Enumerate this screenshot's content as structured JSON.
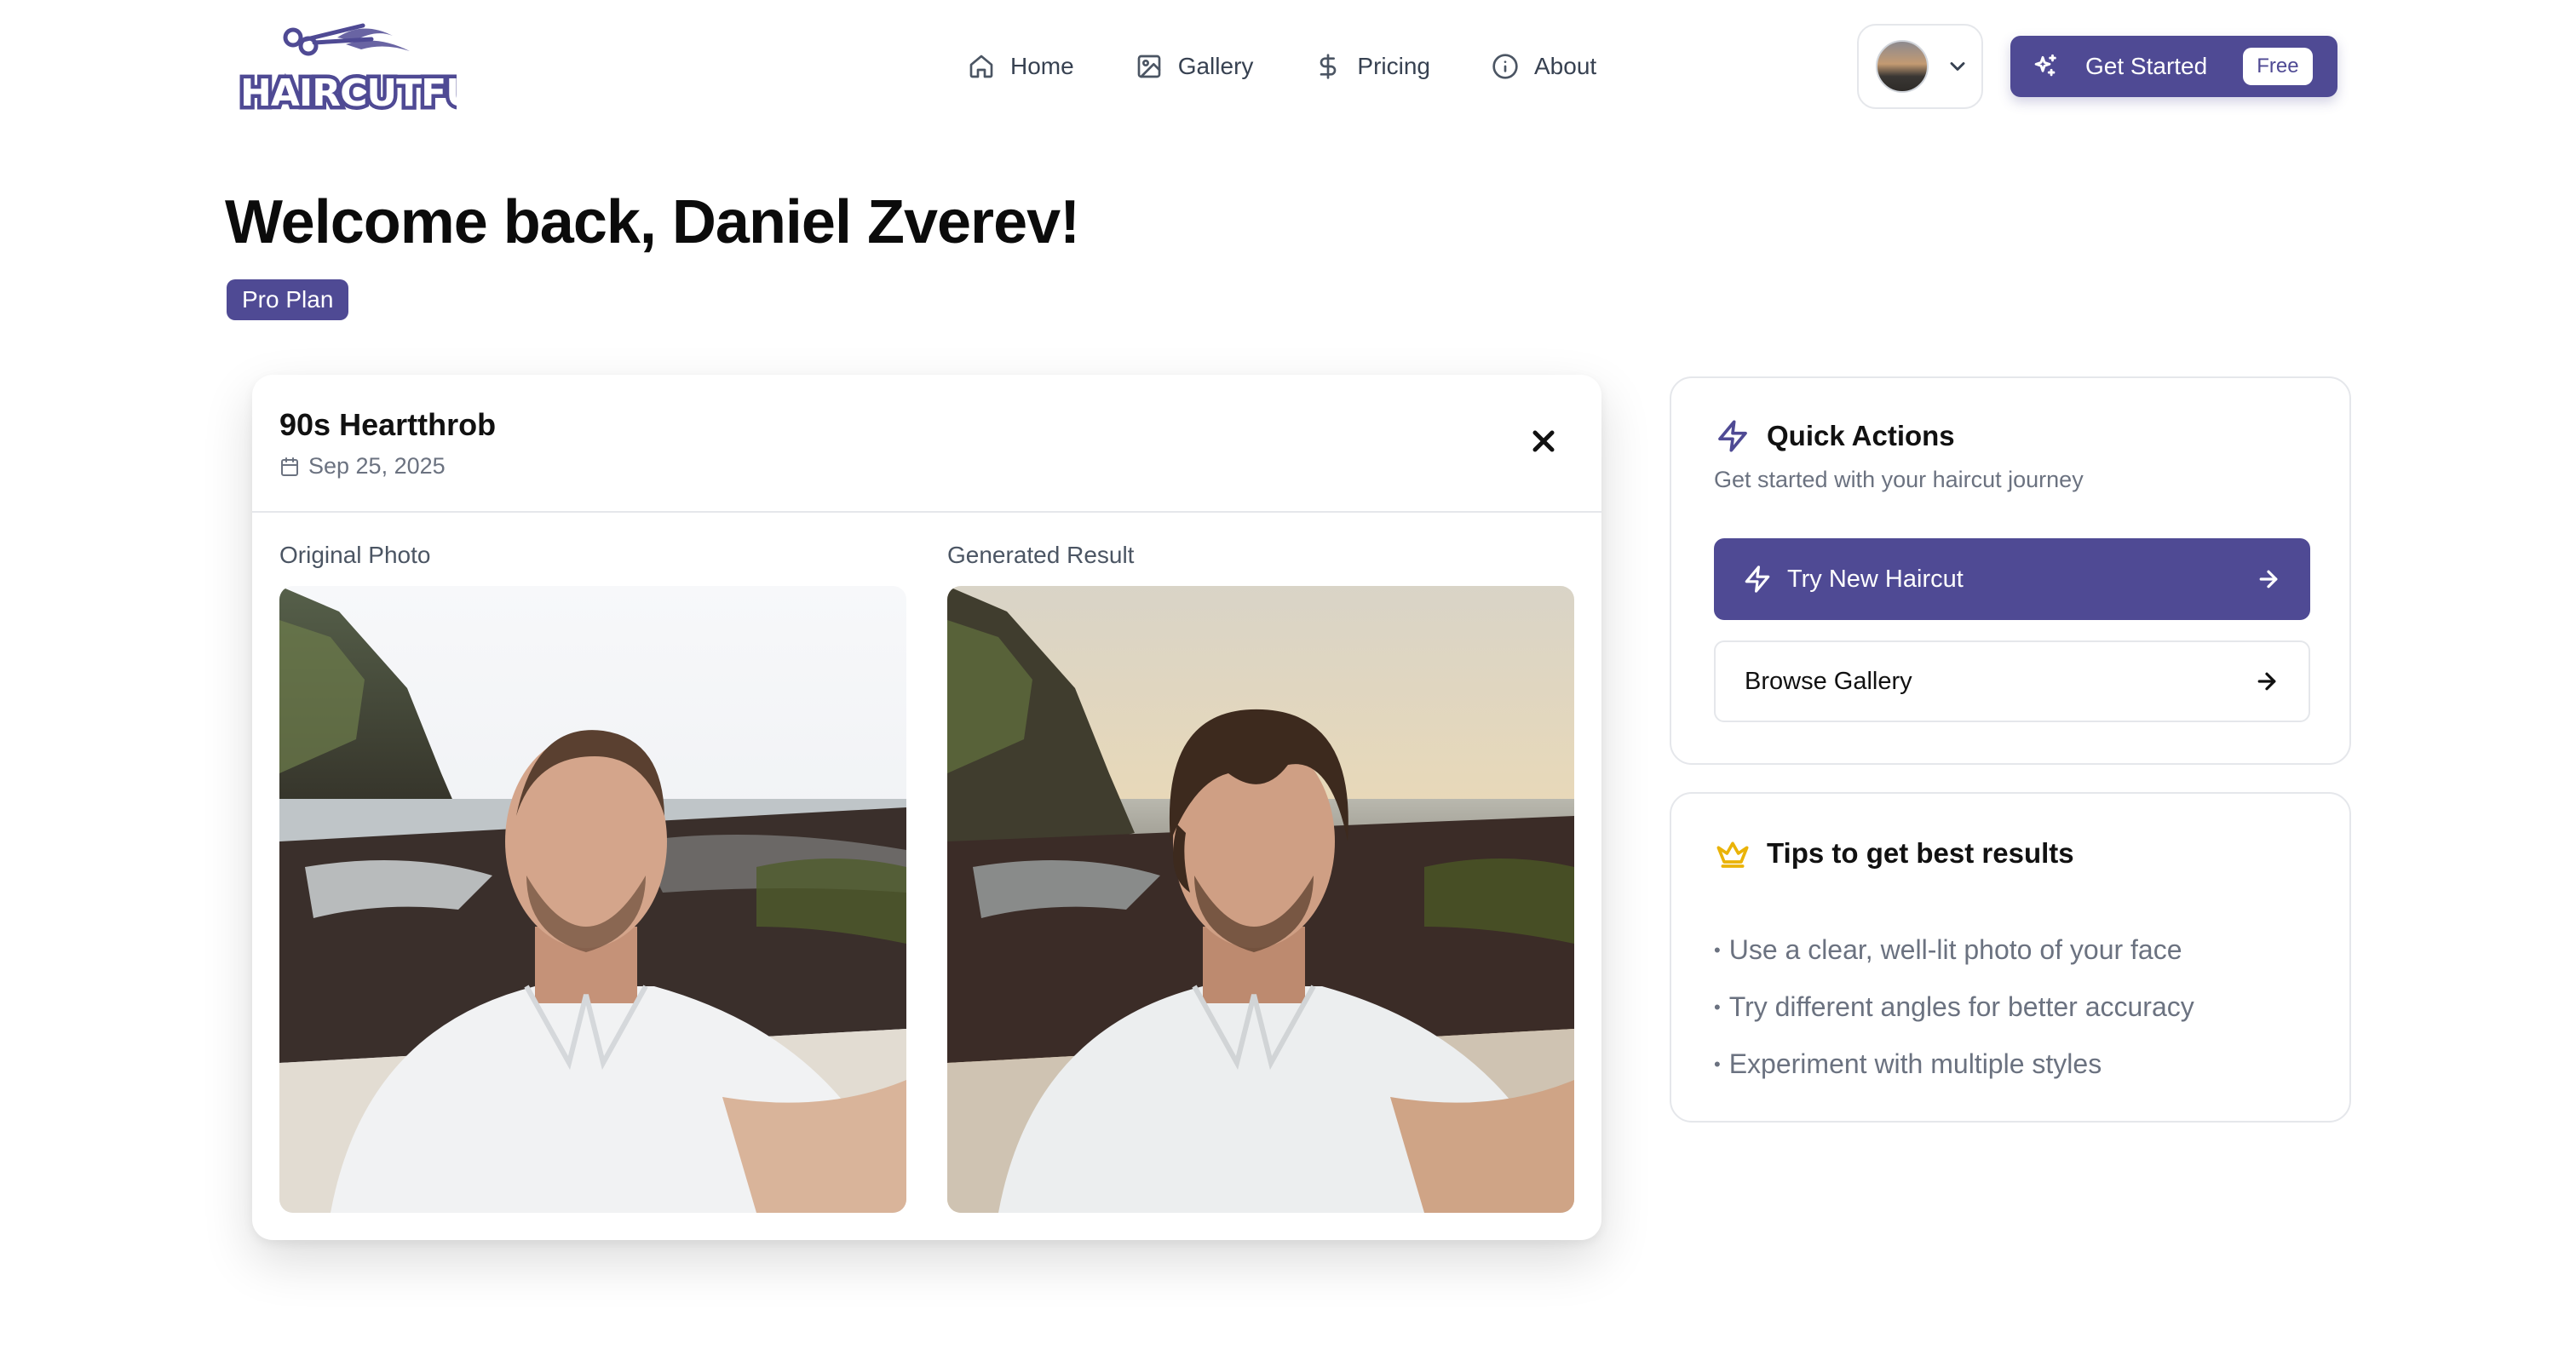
{
  "brand": {
    "logo_text": "HAIRCUTFUN"
  },
  "nav": {
    "items": [
      {
        "label": "Home",
        "icon": "home-icon"
      },
      {
        "label": "Gallery",
        "icon": "image-icon"
      },
      {
        "label": "Pricing",
        "icon": "dollar-icon"
      },
      {
        "label": "About",
        "icon": "info-icon"
      }
    ]
  },
  "header": {
    "get_started_label": "Get Started",
    "free_badge": "Free"
  },
  "welcome": {
    "title": "Welcome back, Daniel Zverev!",
    "plan": "Pro Plan"
  },
  "modal": {
    "title": "90s Heartthrob",
    "date": "Sep 25, 2025",
    "original_label": "Original Photo",
    "generated_label": "Generated Result"
  },
  "quick_actions": {
    "title": "Quick Actions",
    "subtitle": "Get started with your haircut journey",
    "primary_label": "Try New Haircut",
    "secondary_label": "Browse Gallery"
  },
  "tips": {
    "title": "Tips to get best results",
    "items": [
      "Use a clear, well-lit photo of your face",
      "Try different angles for better accuracy",
      "Experiment with multiple styles"
    ]
  },
  "colors": {
    "accent": "#4f4a94",
    "tips_icon": "#eab308"
  }
}
